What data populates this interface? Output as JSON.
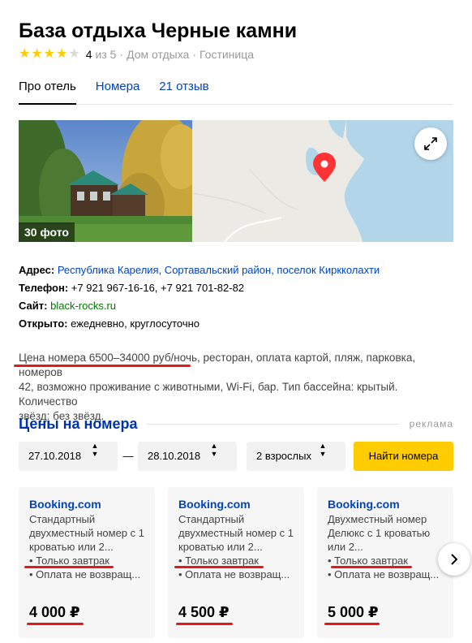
{
  "hotel": {
    "title": "База отдыха Черные камни",
    "rating_value": "4",
    "rating_suffix": "из 5",
    "stars_filled": 4,
    "stars_total": 5,
    "category1": "Дом отдыха",
    "category2": "Гостиница",
    "separator": "·"
  },
  "tabs": [
    {
      "label": "Про отель",
      "active": true
    },
    {
      "label": "Номера",
      "active": false
    },
    {
      "label": "21 отзыв",
      "active": false
    }
  ],
  "media": {
    "photo_count": "30 фото",
    "expand_icon": "expand-icon"
  },
  "info": {
    "address_label": "Адрес:",
    "address_value": "Республика Карелия, Сортавальский район, поселок Киркколахти",
    "phone_label": "Телефон:",
    "phone_value": "+7 921 967-16-16, +7 921 701-82-82",
    "site_label": "Сайт:",
    "site_value": "black-rocks.ru",
    "open_label": "Открыто:",
    "open_value": "ежедневно, круглосуточно"
  },
  "description": {
    "line1": "Цена номера 6500–34000 руб/ночь, ресторан, оплата картой, пляж, парковка, номеров",
    "line2": "42, возможно проживание с животными, Wi-Fi, бар. Тип бассейна: крытый. Количество",
    "line3": "звёзд: без звёзд."
  },
  "prices": {
    "title": "Цены на номера",
    "ad_label": "реклама",
    "checkin": "27.10.2018",
    "dash": "—",
    "checkout": "28.10.2018",
    "guests": "2 взрослых",
    "search_button": "Найти номера",
    "arrow_glyph": "▲▼"
  },
  "offers": [
    {
      "source": "Booking.com",
      "room": "Стандартный двухместный номер с 1 кроватью или 2...",
      "feature1": "• Только завтрак",
      "feature2": "• Оплата не возвращ...",
      "price": "4 000 ₽"
    },
    {
      "source": "Booking.com",
      "room": "Стандартный двухместный номер с 1 кроватью или 2...",
      "feature1": "• Только завтрак",
      "feature2": "• Оплата не возвращ...",
      "price": "4 500 ₽"
    },
    {
      "source": "Booking.com",
      "room": "Двухместный номер Делюкс с 1 кроватью или 2...",
      "feature1": "• Только завтрак",
      "feature2": "• Оплата не возвращ...",
      "price": "5 000 ₽"
    }
  ],
  "colors": {
    "link": "#0044bb",
    "section_title": "#0033aa",
    "site_link": "#007700",
    "button": "#ffcc00",
    "star": "#ffcc00",
    "annotation_underline": "#e21a1a"
  }
}
